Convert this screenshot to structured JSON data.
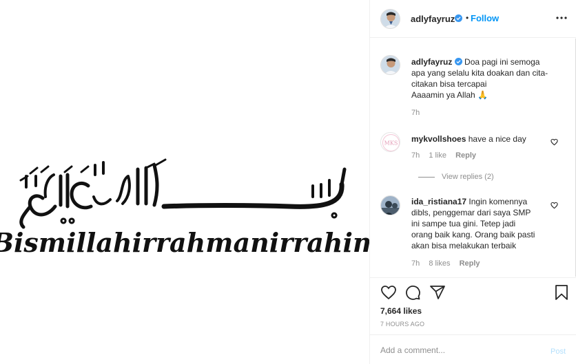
{
  "post_image": {
    "latin_text": "Bismillahirrahmanirrahim"
  },
  "header": {
    "username": "adlyfayruz",
    "dot": "•",
    "follow_label": "Follow"
  },
  "caption": {
    "username": "adlyfayruz",
    "lines": [
      "Doa pagi ini semoga",
      "apa yang selalu kita doakan dan cita-",
      "citakan bisa tercapai",
      "Aaaamin ya Allah 🙏"
    ],
    "time": "7h"
  },
  "comments": [
    {
      "username": "mykvollshoes",
      "avatar_text": "MKS",
      "lines": [
        "have a nice day"
      ],
      "time": "7h",
      "likes": "1 like",
      "reply_label": "Reply",
      "view_replies": "View replies (2)"
    },
    {
      "username": "ida_ristiana17",
      "lines": [
        "Ingin komennya",
        "dibls, penggemar dari saya SMP",
        "ini sampe tua gini. Tetep jadi",
        "orang baik kang. Orang baik pasti",
        "akan bisa melakukan terbaik"
      ],
      "time": "7h",
      "likes": "8 likes",
      "reply_label": "Reply"
    }
  ],
  "actions": {
    "likes": "7,664 likes",
    "time_ago": "7 HOURS AGO"
  },
  "add_comment": {
    "placeholder": "Add a comment...",
    "post_label": "Post"
  },
  "colors": {
    "link_blue": "#0095f6",
    "post_disabled": "#b2dffc",
    "muted": "#8e8e8e",
    "text": "#262626"
  }
}
